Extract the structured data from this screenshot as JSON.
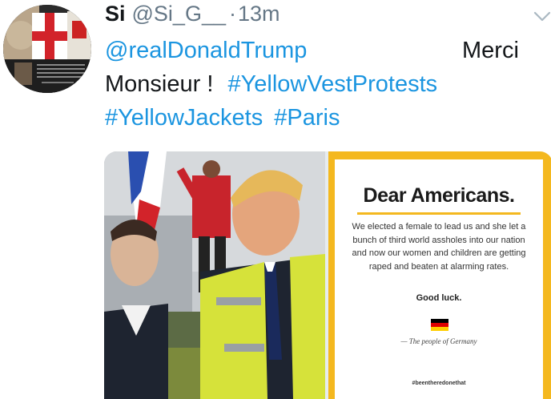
{
  "tweet": {
    "display_name": "Si",
    "handle": "@Si_G__",
    "separator": "·",
    "time": "13m",
    "mention": "@realDonaldTrump",
    "text_merci": "Merci",
    "text_monsieur": "Monsieur !",
    "hashtags": [
      "#YellowVestProtests",
      "#YellowJackets",
      "#Paris"
    ]
  },
  "media": {
    "poster": {
      "title": "Dear Americans.",
      "body": "We elected a female to lead us and she let a bunch of third world assholes into our nation and now our women and children are getting raped and beaten at alarming rates.",
      "good_luck": "Good luck.",
      "signature": "— The people of Germany",
      "footer_hashtag": "#beentheredonethat"
    }
  },
  "colors": {
    "link": "#1b95e0",
    "muted": "#657786",
    "poster_border": "#f4b81f"
  },
  "icons": {
    "caret": "chevron-down-icon",
    "flag": "germany-flag-icon"
  }
}
